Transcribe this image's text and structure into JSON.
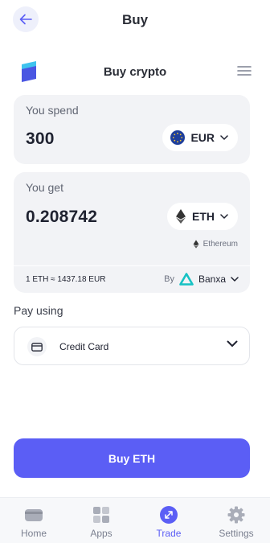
{
  "header": {
    "title": "Buy",
    "back_icon": "arrow-left-icon"
  },
  "widget": {
    "title": "Buy crypto",
    "menu_icon": "hamburger-menu-icon"
  },
  "spend": {
    "label": "You spend",
    "amount": "300",
    "currency": "EUR",
    "currency_icon": "eur-flag-icon"
  },
  "get": {
    "label": "You get",
    "amount": "0.208742",
    "currency": "ETH",
    "currency_name": "Ethereum",
    "currency_icon": "ethereum-icon"
  },
  "rate": {
    "text": "1 ETH ≈ 1437.18 EUR",
    "by_label": "By",
    "provider": "Banxa"
  },
  "payment": {
    "label": "Pay using",
    "method": "Credit Card",
    "method_icon": "credit-card-icon"
  },
  "cta": {
    "label": "Buy ETH"
  },
  "tabs": [
    {
      "label": "Home",
      "icon": "wallet-icon",
      "active": false
    },
    {
      "label": "Apps",
      "icon": "apps-grid-icon",
      "active": false
    },
    {
      "label": "Trade",
      "icon": "trade-icon",
      "active": true
    },
    {
      "label": "Settings",
      "icon": "gear-icon",
      "active": false
    }
  ],
  "colors": {
    "accent": "#5b5ef5",
    "card_bg": "#f2f3f6",
    "text_primary": "#1f2230",
    "text_muted": "#616673"
  }
}
